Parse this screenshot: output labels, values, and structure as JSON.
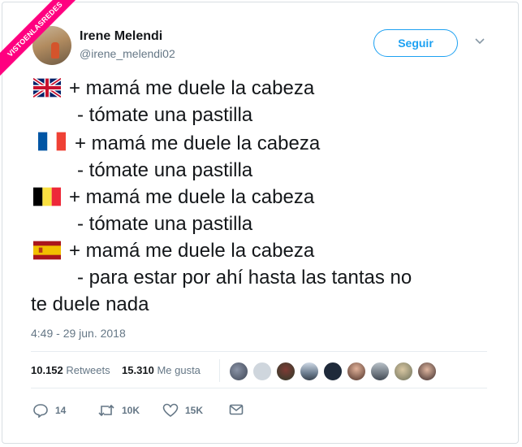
{
  "watermark": "VISTOENLASREDES",
  "user": {
    "name": "Irene Melendi",
    "handle": "@irene_melendi02"
  },
  "follow_label": "Seguir",
  "tweet_lines": [
    "+ mamá me duele la cabeza",
    "- tómate una pastilla",
    "+ mamá me duele la cabeza",
    "- tómate una pastilla",
    "+ mamá me duele la cabeza",
    "- tómate una pastilla",
    "+ mamá me duele la cabeza",
    "- para estar por ahí hasta las tantas no",
    "te duele nada"
  ],
  "flags": [
    "uk-flag-icon",
    "france-flag-icon",
    "belgium-flag-icon",
    "spain-flag-icon"
  ],
  "timestamp": "4:49 - 29 jun. 2018",
  "stats": {
    "retweets_count": "10.152",
    "retweets_label": "Retweets",
    "likes_count": "15.310",
    "likes_label": "Me gusta"
  },
  "actions": {
    "replies": "14",
    "retweets": "10K",
    "likes": "15K"
  },
  "colors": {
    "accent": "#1da1f2",
    "muted": "#657786",
    "text": "#14171a",
    "watermark": "#ff0080"
  }
}
